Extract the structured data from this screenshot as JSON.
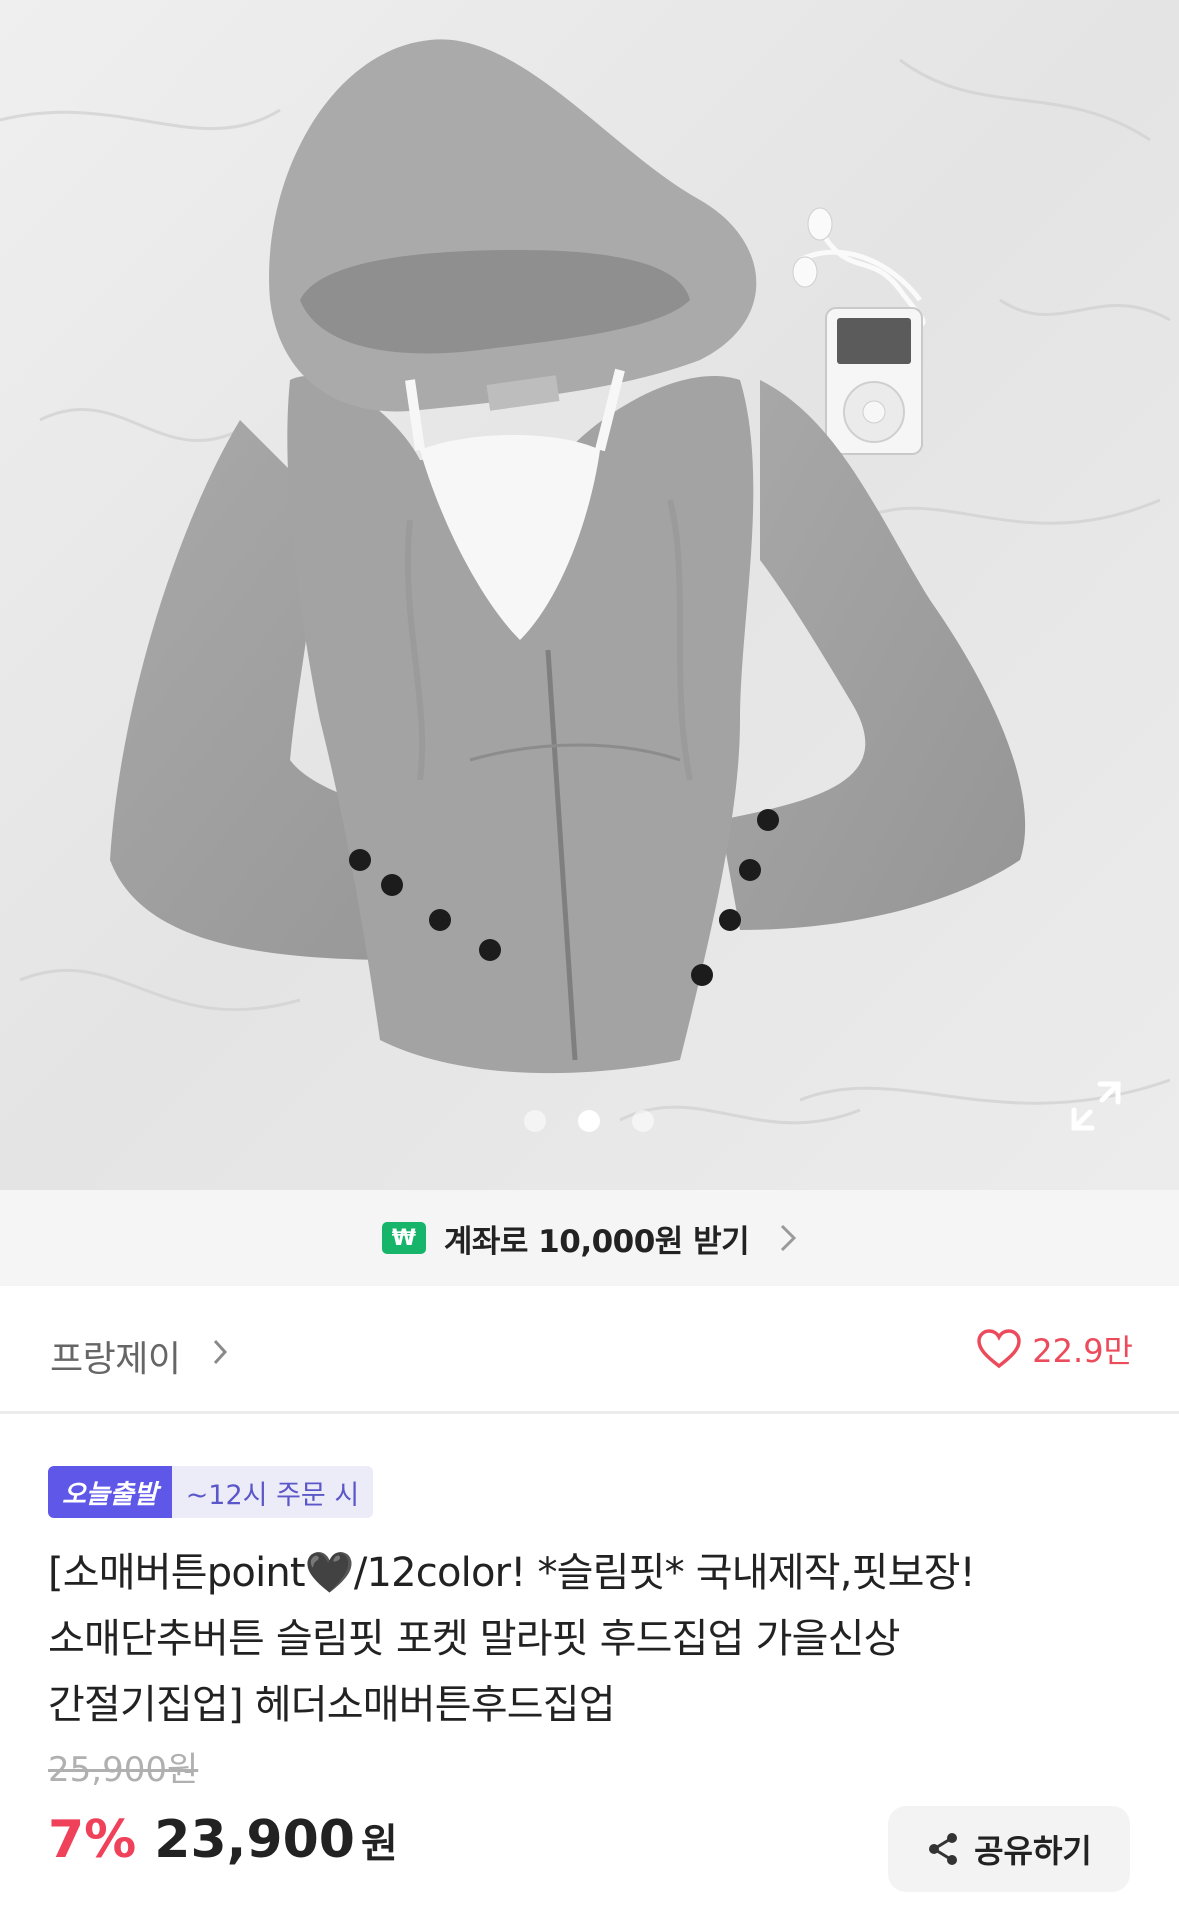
{
  "gallery": {
    "image_alt": "회색 후드집업 상품 이미지",
    "slide_count": 3,
    "active_slide": 2
  },
  "promo": {
    "badge": "₩",
    "text": "계좌로 10,000원 받기"
  },
  "store": {
    "name": "프랑제이",
    "like_count": "22.9만"
  },
  "badges": {
    "today": "오늘출발",
    "cutoff": "~12시 주문 시"
  },
  "product": {
    "title_line1": "[소매버튼point🖤/12color! *슬림핏* 국내제작,핏보장!",
    "title_line2": "소매단추버튼 슬림핏 포켓 말라핏 후드집업 가을신상",
    "title_line3": "간절기집업] 헤더소매버튼후드집업",
    "original_price": "25,900원",
    "discount": "7%",
    "price": "23,900",
    "price_unit": "원"
  },
  "share": {
    "label": "공유하기"
  },
  "colors": {
    "accent_red": "#f0415b",
    "badge_purple": "#5e57e8",
    "promo_green": "#16b56a"
  }
}
